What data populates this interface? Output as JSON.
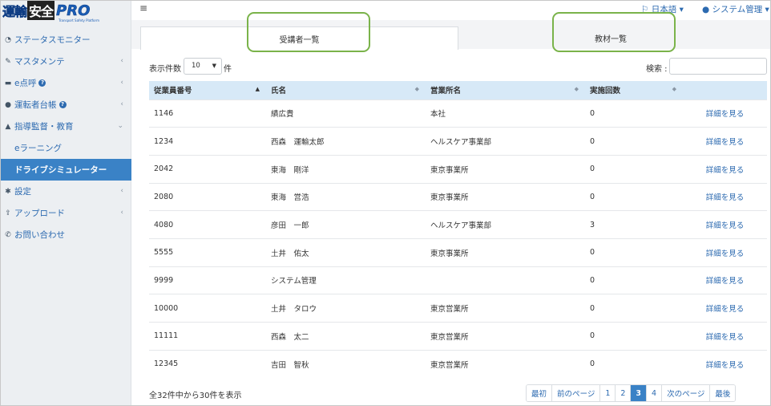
{
  "logo": {
    "part1": "運輸",
    "part2": "安全",
    "pro": "PRO",
    "tagline": "Transport Safety Platform"
  },
  "sidebar": {
    "items": [
      {
        "label": "ステータスモニター",
        "icon": "dashboard-icon",
        "help": false,
        "chevron": ""
      },
      {
        "label": "マスタメンテ",
        "icon": "wrench-icon",
        "help": false,
        "chevron": "‹"
      },
      {
        "label": "e点呼",
        "icon": "truck-icon",
        "help": true,
        "chevron": "‹"
      },
      {
        "label": "運転者台帳",
        "icon": "user-icon",
        "help": true,
        "chevron": "‹"
      },
      {
        "label": "指導監督・教育",
        "icon": "graduation-cap-icon",
        "help": false,
        "chevron": "⌄"
      }
    ],
    "subitems": [
      {
        "label": "eラーニング"
      },
      {
        "label": "ドライブシミュレーター"
      }
    ],
    "items2": [
      {
        "label": "設定",
        "icon": "gear-icon",
        "chevron": "‹"
      },
      {
        "label": "アップロード",
        "icon": "upload-icon",
        "chevron": "‹"
      },
      {
        "label": "お問い合わせ",
        "icon": "phone-icon",
        "chevron": ""
      }
    ]
  },
  "topbar": {
    "language": "日本語",
    "user": "システム管理"
  },
  "tabs": [
    {
      "label": "受講者一覧"
    },
    {
      "label": "教材一覧"
    }
  ],
  "controls": {
    "show_label": "表示件数",
    "show_value": "10",
    "show_unit": "件",
    "search_label": "検索 :"
  },
  "table": {
    "headers": [
      "従業員番号",
      "氏名",
      "営業所名",
      "実施回数",
      ""
    ],
    "rows": [
      [
        "1146",
        "績広貴",
        "本社",
        "0",
        "詳細を見る"
      ],
      [
        "1234",
        "西森　運輸太郎",
        "ヘルスケア事業部",
        "0",
        "詳細を見る"
      ],
      [
        "2042",
        "東海　剛洋",
        "東京事業所",
        "0",
        "詳細を見る"
      ],
      [
        "2080",
        "東海　営浩",
        "東京事業所",
        "0",
        "詳細を見る"
      ],
      [
        "4080",
        "彦田　一郎",
        "ヘルスケア事業部",
        "3",
        "詳細を見る"
      ],
      [
        "5555",
        "土井　佑太",
        "東京事業所",
        "0",
        "詳細を見る"
      ],
      [
        "9999",
        "システム管理",
        "",
        "0",
        "詳細を見る"
      ],
      [
        "10000",
        "土井　タロウ",
        "東京営業所",
        "0",
        "詳細を見る"
      ],
      [
        "11111",
        "西森　太二",
        "東京営業所",
        "0",
        "詳細を見る"
      ],
      [
        "12345",
        "吉田　智秋",
        "東京営業所",
        "0",
        "詳細を見る"
      ]
    ]
  },
  "summary": "全32件中から30件を表示",
  "pagination": [
    "最初",
    "前のページ",
    "1",
    "2",
    "3",
    "4",
    "次のページ",
    "最後"
  ],
  "pagination_current": "3",
  "colors": {
    "accent": "#3a82c6",
    "link": "#2c6ab0",
    "header_bg": "#d7e9f7",
    "highlight": "#7ab34a"
  }
}
